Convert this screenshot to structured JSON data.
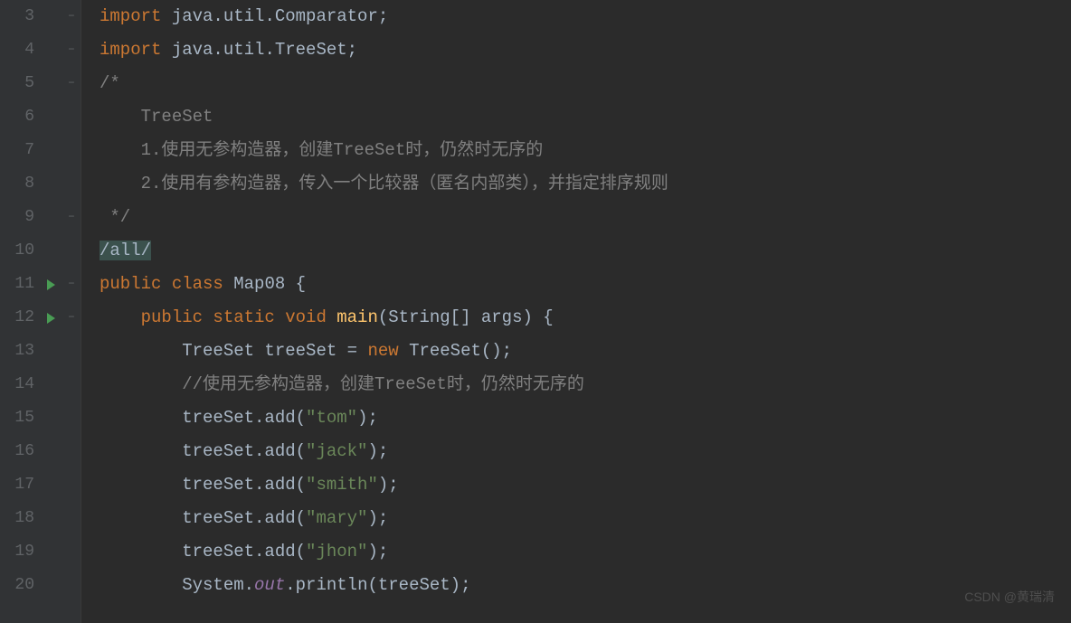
{
  "watermark": "CSDN @黄瑞清",
  "lines": [
    {
      "num": "3",
      "fold": "⊟",
      "tokens": [
        {
          "cls": "kw",
          "t": "import "
        },
        {
          "cls": "plain",
          "t": "java.util.Comparator;"
        }
      ]
    },
    {
      "num": "4",
      "fold": "⊟",
      "tokens": [
        {
          "cls": "kw",
          "t": "import "
        },
        {
          "cls": "plain",
          "t": "java.util.TreeSet;"
        }
      ]
    },
    {
      "num": "5",
      "fold": "⊟",
      "tokens": [
        {
          "cls": "comment",
          "t": "/*"
        }
      ]
    },
    {
      "num": "6",
      "tokens": [
        {
          "cls": "comment",
          "t": "    TreeSet"
        }
      ]
    },
    {
      "num": "7",
      "tokens": [
        {
          "cls": "comment",
          "t": "    1.使用无参构造器，创建TreeSet时，仍然时无序的"
        }
      ]
    },
    {
      "num": "8",
      "tokens": [
        {
          "cls": "comment",
          "t": "    2.使用有参构造器，传入一个比较器（匿名内部类），并指定排序规则"
        }
      ]
    },
    {
      "num": "9",
      "fold": "⊖",
      "tokens": [
        {
          "cls": "comment",
          "t": " */"
        }
      ]
    },
    {
      "num": "10",
      "tokens": [
        {
          "cls": "suppressed",
          "t": "/all/"
        }
      ]
    },
    {
      "num": "11",
      "run": true,
      "fold": "⊟",
      "tokens": [
        {
          "cls": "kw",
          "t": "public class "
        },
        {
          "cls": "plain",
          "t": "Map08 {"
        }
      ]
    },
    {
      "num": "12",
      "run": true,
      "fold": "⊟",
      "indent": 1,
      "tokens": [
        {
          "cls": "plain",
          "t": "    "
        },
        {
          "cls": "kw",
          "t": "public static void "
        },
        {
          "cls": "method-decl",
          "t": "main"
        },
        {
          "cls": "plain",
          "t": "(String[] args) {"
        }
      ]
    },
    {
      "num": "13",
      "indent": 2,
      "tokens": [
        {
          "cls": "plain",
          "t": "        TreeSet treeSet = "
        },
        {
          "cls": "kw",
          "t": "new "
        },
        {
          "cls": "plain",
          "t": "TreeSet();"
        }
      ]
    },
    {
      "num": "14",
      "indent": 2,
      "tokens": [
        {
          "cls": "plain",
          "t": "        "
        },
        {
          "cls": "comment",
          "t": "//使用无参构造器，创建TreeSet时，仍然时无序的"
        }
      ]
    },
    {
      "num": "15",
      "indent": 2,
      "tokens": [
        {
          "cls": "plain",
          "t": "        treeSet.add("
        },
        {
          "cls": "str",
          "t": "\"tom\""
        },
        {
          "cls": "plain",
          "t": ");"
        }
      ]
    },
    {
      "num": "16",
      "indent": 2,
      "tokens": [
        {
          "cls": "plain",
          "t": "        treeSet.add("
        },
        {
          "cls": "str",
          "t": "\"jack\""
        },
        {
          "cls": "plain",
          "t": ");"
        }
      ]
    },
    {
      "num": "17",
      "indent": 2,
      "tokens": [
        {
          "cls": "plain",
          "t": "        treeSet.add("
        },
        {
          "cls": "str",
          "t": "\"smith\""
        },
        {
          "cls": "plain",
          "t": ");"
        }
      ]
    },
    {
      "num": "18",
      "indent": 2,
      "tokens": [
        {
          "cls": "plain",
          "t": "        treeSet.add("
        },
        {
          "cls": "str",
          "t": "\"mary\""
        },
        {
          "cls": "plain",
          "t": ");"
        }
      ]
    },
    {
      "num": "19",
      "indent": 2,
      "tokens": [
        {
          "cls": "plain",
          "t": "        treeSet.add("
        },
        {
          "cls": "str",
          "t": "\"jhon\""
        },
        {
          "cls": "plain",
          "t": ");"
        }
      ]
    },
    {
      "num": "20",
      "indent": 2,
      "tokens": [
        {
          "cls": "plain",
          "t": "        System."
        },
        {
          "cls": "field-static",
          "t": "out"
        },
        {
          "cls": "plain",
          "t": ".println(treeSet);"
        }
      ]
    }
  ]
}
